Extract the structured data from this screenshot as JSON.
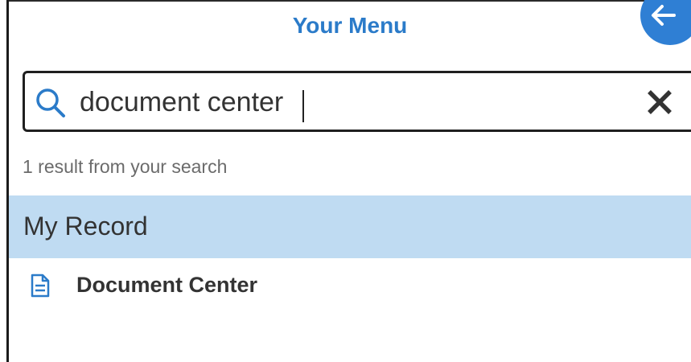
{
  "header": {
    "title": "Your Menu",
    "back_icon": "arrow-left-icon"
  },
  "search": {
    "value": "document center",
    "placeholder": "",
    "search_icon": "search-icon",
    "clear_icon": "close-icon"
  },
  "results": {
    "count_text": "1 result from your search",
    "sections": [
      {
        "label": "My Record",
        "items": [
          {
            "label": "Document Center",
            "icon": "document-icon"
          }
        ]
      }
    ]
  },
  "colors": {
    "accent": "#2b7bc9",
    "back_button": "#2f7fd4",
    "section_bg": "#bfdbf2",
    "text": "#333333",
    "muted": "#6b6b6b"
  }
}
